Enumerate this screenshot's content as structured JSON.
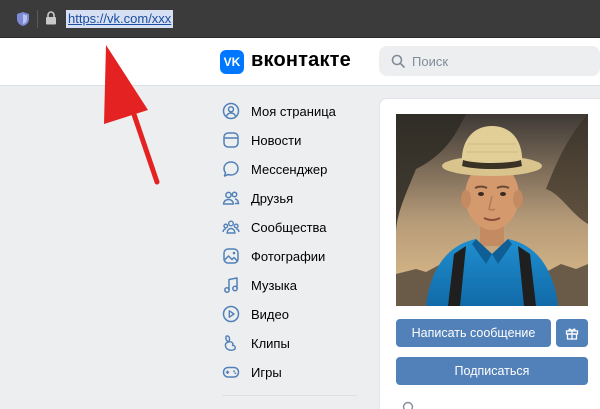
{
  "browser": {
    "url": "https://vk.com/xxx"
  },
  "header": {
    "logo_letters": "VK",
    "brand": "вконтакте",
    "search_placeholder": "Поиск"
  },
  "menu": {
    "items": [
      {
        "label": "Моя страница",
        "icon": "user-circle-icon"
      },
      {
        "label": "Новости",
        "icon": "news-icon"
      },
      {
        "label": "Мессенджер",
        "icon": "message-bubble-icon"
      },
      {
        "label": "Друзья",
        "icon": "friends-icon"
      },
      {
        "label": "Сообщества",
        "icon": "communities-icon"
      },
      {
        "label": "Фотографии",
        "icon": "photos-icon"
      },
      {
        "label": "Музыка",
        "icon": "music-note-icon"
      },
      {
        "label": "Видео",
        "icon": "play-circle-icon"
      },
      {
        "label": "Клипы",
        "icon": "clips-icon"
      },
      {
        "label": "Игры",
        "icon": "gamepad-icon"
      }
    ]
  },
  "profile": {
    "message_button": "Написать сообщение",
    "subscribe_button": "Подписаться"
  },
  "colors": {
    "accent": "#5181b8",
    "vk_blue": "#0077ff",
    "arrow": "#e52222"
  }
}
